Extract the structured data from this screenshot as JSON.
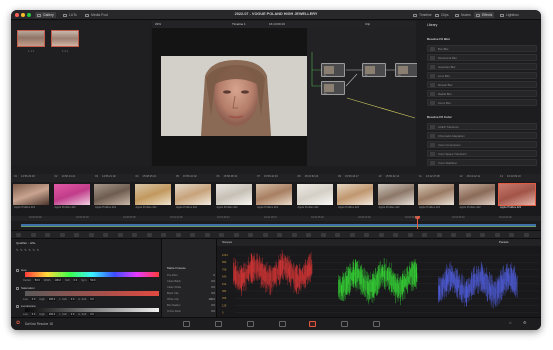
{
  "topbar": {
    "buttons_left": [
      {
        "label": "Gallery",
        "active": true
      },
      {
        "label": "LUTs",
        "active": false
      },
      {
        "label": "Media Pool",
        "active": false
      }
    ],
    "project_title": "2022-07 - VOGUE POLAND HIGH JEWELLERY",
    "buttons_right": [
      {
        "label": "Timeline",
        "active": false
      },
      {
        "label": "Clips",
        "active": false
      },
      {
        "label": "Nodes",
        "active": false
      },
      {
        "label": "Effects",
        "active": true
      },
      {
        "label": "Lightbox",
        "active": false
      }
    ]
  },
  "gallery": {
    "stills": [
      {
        "label": "1.1.1"
      },
      {
        "label": "1.2.1"
      }
    ]
  },
  "viewer": {
    "zoom": "29%",
    "timeline_name": "Timeline 1",
    "timecode_in": "16:13:09:10",
    "clip_mode": "Clip",
    "timecode": "01:11:57:22"
  },
  "nodes": {
    "labels": [
      "01",
      "02",
      "03",
      "04",
      "05"
    ]
  },
  "library": {
    "tab": "Library",
    "section1_title": "Resolve FX Blur",
    "blur_items": [
      "Box Blur",
      "Directional Blur",
      "Gaussian Blur",
      "Lens Blur",
      "Mosaic Blur",
      "Radial Blur",
      "Zoom Blur"
    ],
    "section2_title": "Resolve FX Color",
    "color_items": [
      "ACES Transform",
      "Chromatic Adaptation",
      "Color Compressor",
      "Color Space Transform",
      "Color Stabilizer"
    ]
  },
  "clips": [
    {
      "num": "01",
      "tc": "14:56:29:18",
      "label": "Apple ProRes 422"
    },
    {
      "num": "02",
      "tc": "14:56:14:21",
      "label": "Apple ProRes 422"
    },
    {
      "num": "03",
      "tc": "14:56:21:02",
      "label": "Apple ProRes 422"
    },
    {
      "num": "04",
      "tc": "15:08:25:21",
      "label": "Apple ProRes 422"
    },
    {
      "num": "05",
      "tc": "15:56:10:02",
      "label": "Apple ProRes 422"
    },
    {
      "num": "06",
      "tc": "15:56:08:13",
      "label": "Apple ProRes 422"
    },
    {
      "num": "07",
      "tc": "15:56:44:03",
      "label": "Apple ProRes 422"
    },
    {
      "num": "08",
      "tc": "15:31:52:24",
      "label": "Apple ProRes 422"
    },
    {
      "num": "09",
      "tc": "15:50:44:17",
      "label": "Apple ProRes 422"
    },
    {
      "num": "10",
      "tc": "15:56:42:12",
      "label": "Apple ProRes 422"
    },
    {
      "num": "11",
      "tc": "16:12:47:08",
      "label": "Apple ProRes 422"
    },
    {
      "num": "12",
      "tc": "16:13:12:11",
      "label": "Apple ProRes 422"
    },
    {
      "num": "13",
      "tc": "16:13:09:10",
      "label": "Apple ProRes 422"
    }
  ],
  "ruler": [
    "01:00:00:00",
    "01:00:33:18",
    "01:00:56:05",
    "01:01:22:06",
    "01:01:48:12",
    "01:02:15:10",
    "01:02:45:18",
    "01:03:12:00",
    "01:03:36:06",
    "01:04:05:10",
    "01:04:31:02"
  ],
  "qualifier": {
    "title": "Qualifier - HSL",
    "hue": {
      "label": "Hue",
      "center_label": "Center",
      "center": "50.0",
      "width_label": "Width",
      "width": "100.0",
      "soft_label": "Soft",
      "soft": "0.0",
      "sym_label": "Sym",
      "sym": "50.0"
    },
    "saturation": {
      "label": "Saturation",
      "low_label": "Low",
      "low": "0.0",
      "high_label": "High",
      "high": "100.0",
      "lsoft_label": "L. Soft",
      "lsoft": "0.0",
      "hsoft_label": "H. Soft",
      "hsoft": "0.0"
    },
    "luminance": {
      "label": "Luminance",
      "low_label": "Low",
      "low": "0.0",
      "high_label": "High",
      "high": "100.0",
      "lsoft_label": "L. Soft",
      "lsoft": "0.0",
      "hsoft_label": "H. Soft",
      "hsoft": "0.0"
    }
  },
  "matte": {
    "title": "Matte Finesse",
    "rows": [
      {
        "label": "Pre-Filter",
        "value": "0"
      },
      {
        "label": "Clean Black",
        "value": "0.0"
      },
      {
        "label": "Clean White",
        "value": "0.0"
      },
      {
        "label": "Black Clip",
        "value": "0.0"
      },
      {
        "label": "White Clip",
        "value": "100.0"
      },
      {
        "label": "Blur Radius",
        "value": "0.0"
      },
      {
        "label": "In/Out Ratio",
        "value": "0.0"
      }
    ]
  },
  "scopes": {
    "title": "Scopes",
    "mode": "Parade",
    "scale": [
      "1023",
      "896",
      "768",
      "640",
      "512",
      "384",
      "256",
      "128",
      "0"
    ]
  },
  "app": {
    "name": "DaVinci Resolve 18"
  },
  "colors": {
    "accent": "#e25a44",
    "panel": "#1d1d1f",
    "red": "#ff3c3c",
    "green": "#3cff3c",
    "blue": "#5a6aff"
  }
}
